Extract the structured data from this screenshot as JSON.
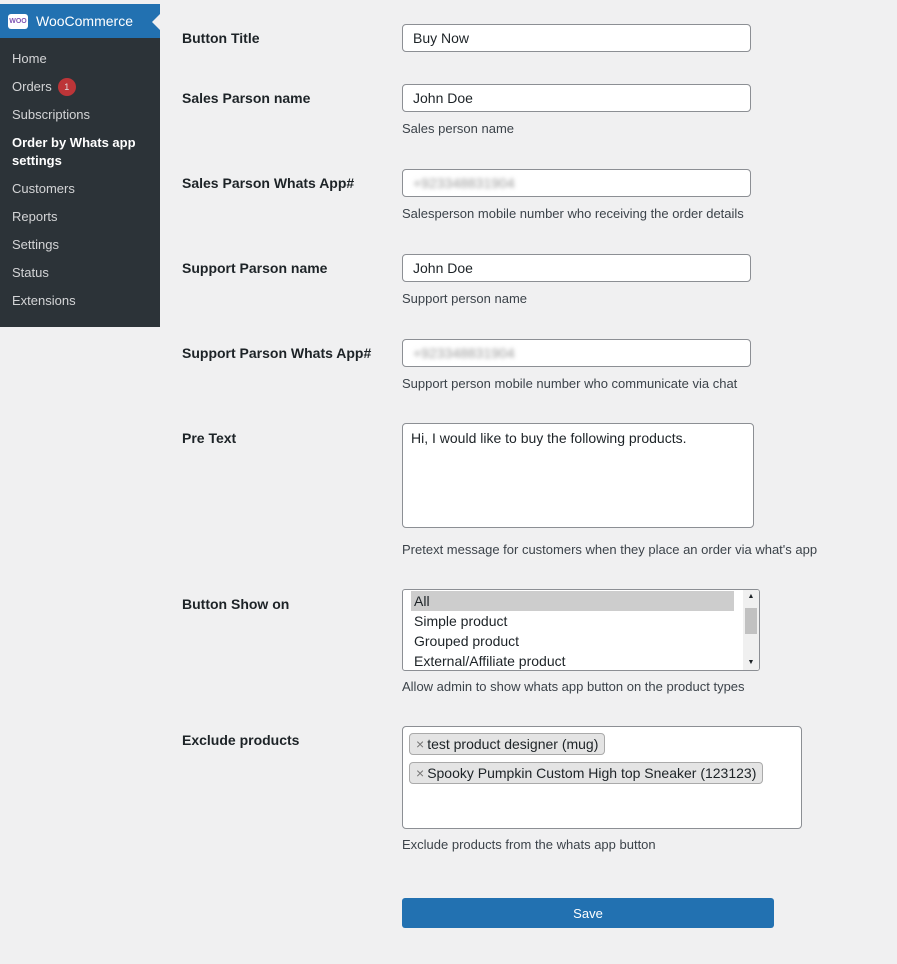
{
  "sidebar": {
    "title": "WooCommerce",
    "logo_text": "Woo",
    "items": [
      {
        "label": "Home"
      },
      {
        "label": "Orders",
        "badge": "1"
      },
      {
        "label": "Subscriptions"
      },
      {
        "label": "Order by Whats app settings",
        "active": true
      },
      {
        "label": "Customers"
      },
      {
        "label": "Reports"
      },
      {
        "label": "Settings"
      },
      {
        "label": "Status"
      },
      {
        "label": "Extensions"
      }
    ]
  },
  "form": {
    "button_title": {
      "label": "Button Title",
      "value": "Buy Now"
    },
    "sales_name": {
      "label": "Sales Parson name",
      "value": "John Doe",
      "desc": "Sales person name"
    },
    "sales_whatsapp": {
      "label": "Sales Parson Whats App#",
      "value": "+923348831904",
      "desc": "Salesperson mobile number who receiving the order details"
    },
    "support_name": {
      "label": "Support Parson name",
      "value": "John Doe",
      "desc": "Support person name"
    },
    "support_whatsapp": {
      "label": "Support Parson Whats App#",
      "value": "+923348831904",
      "desc": "Support person mobile number who communicate via chat"
    },
    "pre_text": {
      "label": "Pre Text",
      "value": "Hi, I would like to buy the following products.",
      "desc": "Pretext message for customers when they place an order via what's app"
    },
    "show_on": {
      "label": "Button Show on",
      "options": [
        "All",
        "Simple product",
        "Grouped product",
        "External/Affiliate product"
      ],
      "selected": "All",
      "desc": "Allow admin to show whats app button on the product types"
    },
    "exclude": {
      "label": "Exclude products",
      "chips": [
        "test product designer (mug)",
        "Spooky Pumpkin Custom High top Sneaker (123123)"
      ],
      "desc": "Exclude products from the whats app button"
    },
    "save_label": "Save"
  }
}
